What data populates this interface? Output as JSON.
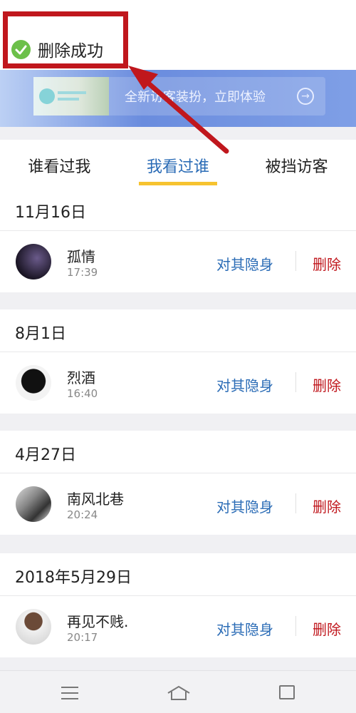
{
  "toast": {
    "message": "删除成功",
    "icon": "check-circle-icon"
  },
  "banner": {
    "text": "全新访客装扮，立即体验",
    "arrow_glyph": "→"
  },
  "tabs": [
    {
      "label": "谁看过我",
      "active": false
    },
    {
      "label": "我看过谁",
      "active": true
    },
    {
      "label": "被挡访客",
      "active": false
    }
  ],
  "groups": [
    {
      "date": "11月16日",
      "entry": {
        "name": "孤情",
        "time": "17:39",
        "hide_label": "对其隐身",
        "delete_label": "删除"
      }
    },
    {
      "date": "8月1日",
      "entry": {
        "name": "烈酒",
        "time": "16:40",
        "hide_label": "对其隐身",
        "delete_label": "删除"
      }
    },
    {
      "date": "4月27日",
      "entry": {
        "name": "南风北巷",
        "time": "20:24",
        "hide_label": "对其隐身",
        "delete_label": "删除"
      }
    },
    {
      "date": "2018年5月29日",
      "entry": {
        "name": "再见不贱.",
        "time": "20:17",
        "hide_label": "对其隐身",
        "delete_label": "删除"
      }
    }
  ],
  "colors": {
    "accent_blue": "#2b6cb6",
    "delete_red": "#c0171d",
    "tab_underline": "#f6c32f",
    "annotation_red": "#c0171d"
  },
  "nav": {
    "icons": [
      "menu-icon",
      "home-icon",
      "back-icon"
    ]
  }
}
